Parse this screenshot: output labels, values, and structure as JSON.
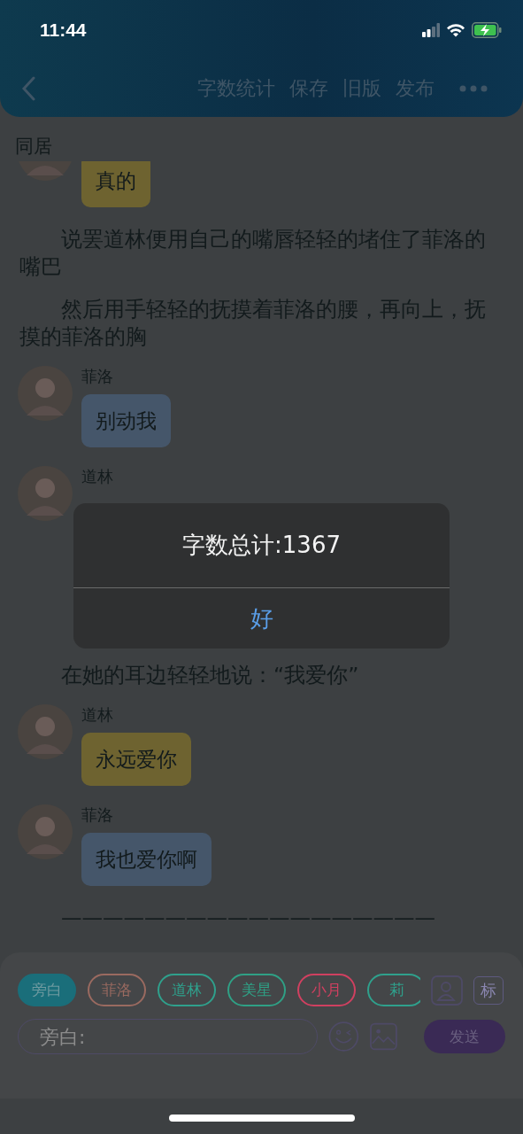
{
  "status_bar": {
    "time": "11:44"
  },
  "nav": {
    "actions": [
      "字数统计",
      "保存",
      "旧版",
      "发布"
    ]
  },
  "title": "同居",
  "messages": [
    {
      "kind": "bubble",
      "text": "真的",
      "color": "#6e6330"
    },
    {
      "kind": "narration",
      "text": "说罢道林便用自己的嘴唇轻轻的堵住了菲洛的嘴巴"
    },
    {
      "kind": "narration",
      "text": "然后用手轻轻的抚摸着菲洛的腰，再向上，抚摸的菲洛的胸"
    },
    {
      "kind": "bubble",
      "speaker": "菲洛",
      "text": "别动我",
      "color": "#45566a"
    },
    {
      "kind": "bubble",
      "speaker": "道林"
    },
    {
      "kind": "narration",
      "text": "在她的耳边轻轻地说：“我爱你”"
    },
    {
      "kind": "bubble",
      "speaker": "道林",
      "text": "永远爱你",
      "color": "#6e6330"
    },
    {
      "kind": "bubble",
      "speaker": "菲洛",
      "text": "我也爱你啊",
      "color": "#45566a"
    },
    {
      "kind": "narration",
      "text": "——————————————————"
    }
  ],
  "roles": [
    {
      "label": "旁白",
      "selected": true,
      "color": "#1a6e7a"
    },
    {
      "label": "菲洛",
      "selected": false,
      "color": "#9a6a60"
    },
    {
      "label": "道林",
      "selected": false,
      "color": "#2fa08c"
    },
    {
      "label": "美星",
      "selected": false,
      "color": "#2fa085"
    },
    {
      "label": "小月",
      "selected": false,
      "color": "#d04060"
    },
    {
      "label": "莉",
      "selected": false,
      "color": "#2fa08c"
    }
  ],
  "tag_button": "标",
  "input": {
    "placeholder": "旁白:"
  },
  "send_button": "发送",
  "alert": {
    "title": "字数总计:1367",
    "button": "好"
  }
}
